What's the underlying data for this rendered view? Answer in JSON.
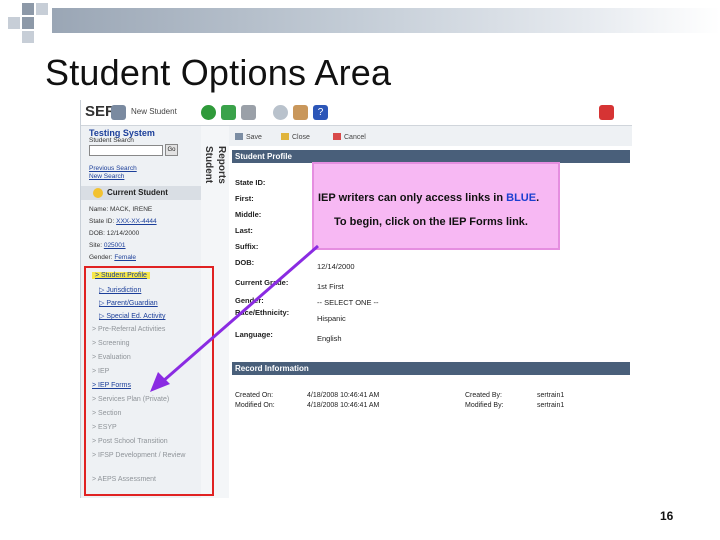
{
  "slide": {
    "title": "Student Options Area",
    "page_number": "16"
  },
  "app": {
    "logo": "SER",
    "new_student": "New Student"
  },
  "left_nav": {
    "heading": "Testing System",
    "student_search_label": "Student Search",
    "go_label": "Go",
    "previous_search": "Previous Search",
    "new_search": "New Search",
    "current_student": "Current Student",
    "name_label": "Name:",
    "name_value": "MACK, IRENE",
    "state_id_label": "State ID:",
    "state_id_value": "XXX-XX-4444",
    "dob_label": "DOB:",
    "dob_value": "12/14/2000",
    "site_label": "Site:",
    "site_value": "025001",
    "gender_label": "Gender:",
    "gender_value": "Female",
    "tab_student": "Student",
    "tab_reports": "Reports",
    "menu": [
      "> Student Profile",
      "▷ Jurisdiction",
      "▷ Parent/Guardian",
      "▷ Special Ed. Activity",
      "> Pre-Referral Activities",
      "> Screening",
      "> Evaluation",
      "> IEP",
      "> IEP Forms",
      "> Services Plan (Private)",
      "> Section",
      "> ESYP",
      "> Post School Transition",
      "> IFSP Development / Review",
      "> AEPS Assessment"
    ]
  },
  "toolbar": {
    "save": "Save",
    "close": "Close",
    "cancel": "Cancel"
  },
  "profile": {
    "section_title": "Student Profile",
    "state_id_label": "State ID:",
    "first_label": "First:",
    "middle_label": "Middle:",
    "last_label": "Last:",
    "suffix_label": "Suffix:",
    "dob_label": "DOB:",
    "dob_value": "12/14/2000",
    "current_grade_label": "Current Grade:",
    "current_grade_value": "1st    First",
    "gender_label": "Gender:",
    "gender_value": "-- SELECT ONE --",
    "race_label": "Race/Ethnicity:",
    "race_value": "Hispanic",
    "language_label": "Language:",
    "language_value": "English"
  },
  "record": {
    "section_title": "Record Information",
    "created_on_label": "Created On:",
    "created_on_value": "4/18/2008 10:46:41 AM",
    "modified_on_label": "Modified On:",
    "modified_on_value": "4/18/2008 10:46:41 AM",
    "created_by_label": "Created By:",
    "created_by_value": "sertrain1",
    "modified_by_label": "Modified By:",
    "modified_by_value": "sertrain1"
  },
  "callout": {
    "line1_prefix": "IEP writers can only access links in ",
    "line1_blue": "BLUE",
    "line1_suffix": ".",
    "line2": "To begin, click on the IEP Forms link."
  },
  "colors": {
    "nav_blue": "#1c3f9a",
    "highlight_red": "#e02222",
    "callout_pink": "#f7b8f3",
    "arrow_purple": "#8a2be2",
    "section_bar": "#495f7a"
  }
}
